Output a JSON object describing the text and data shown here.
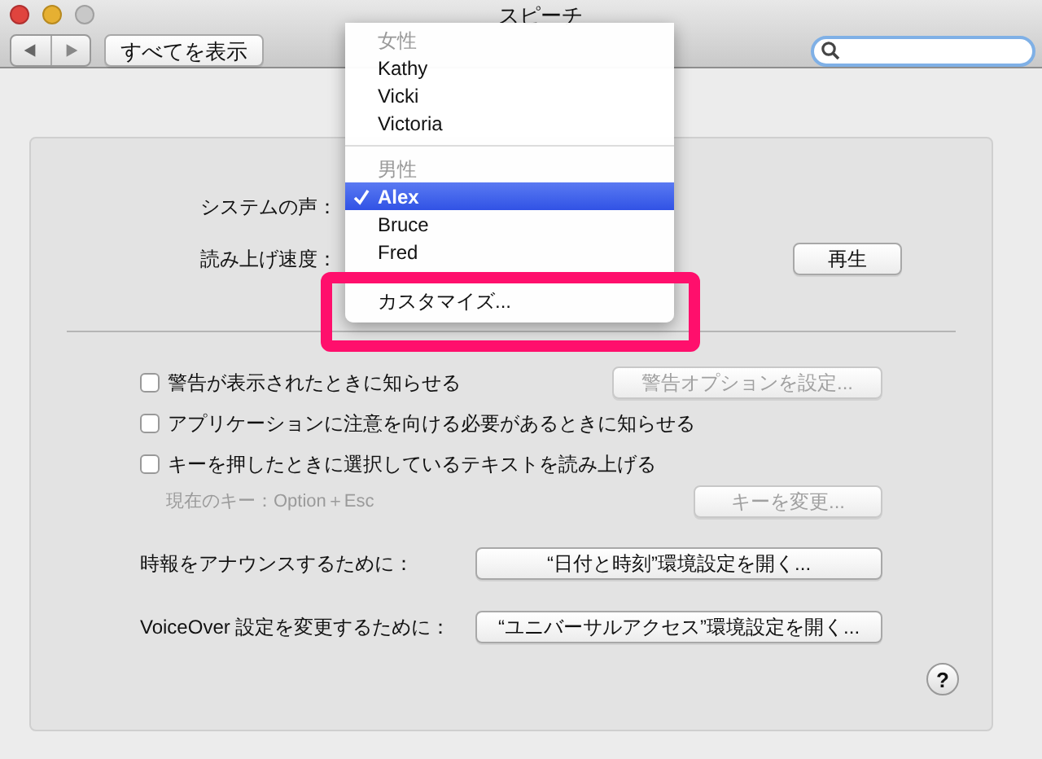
{
  "window": {
    "title": "スピーチ"
  },
  "toolbar": {
    "show_all_button": "すべてを表示"
  },
  "system_voice_label": "システムの声：",
  "rate_label": "読み上げ速度：",
  "play_button": "再生",
  "options": [
    {
      "label": "警告が表示されたときに知らせる",
      "checked": false
    },
    {
      "label": "アプリケーションに注意を向ける必要があるときに知らせる",
      "checked": false
    },
    {
      "label": "キーを押したときに選択しているテキストを読み上げる",
      "checked": false
    }
  ],
  "alert_options_button": {
    "label": "警告オプションを設定...",
    "disabled": true
  },
  "current_key": "現在のキー：Option＋Esc",
  "change_key_button": {
    "label": "キーを変更...",
    "disabled": true
  },
  "links": [
    {
      "label": "時報をアナウンスするために：",
      "button": "“日付と時刻”環境設定を開く..."
    },
    {
      "label": "VoiceOver 設定を変更するために：",
      "button": "“ユニバーサルアクセス”環境設定を開く..."
    }
  ],
  "help_button": "?",
  "voice_menu": {
    "sections": [
      {
        "header": "女性",
        "items": [
          {
            "label": "Kathy",
            "selected": false
          },
          {
            "label": "Vicki",
            "selected": false
          },
          {
            "label": "Victoria",
            "selected": false
          }
        ]
      },
      {
        "header": "男性",
        "items": [
          {
            "label": "Alex",
            "selected": true
          },
          {
            "label": "Bruce",
            "selected": false
          },
          {
            "label": "Fred",
            "selected": false
          }
        ]
      }
    ],
    "footer_item": "カスタマイズ..."
  }
}
